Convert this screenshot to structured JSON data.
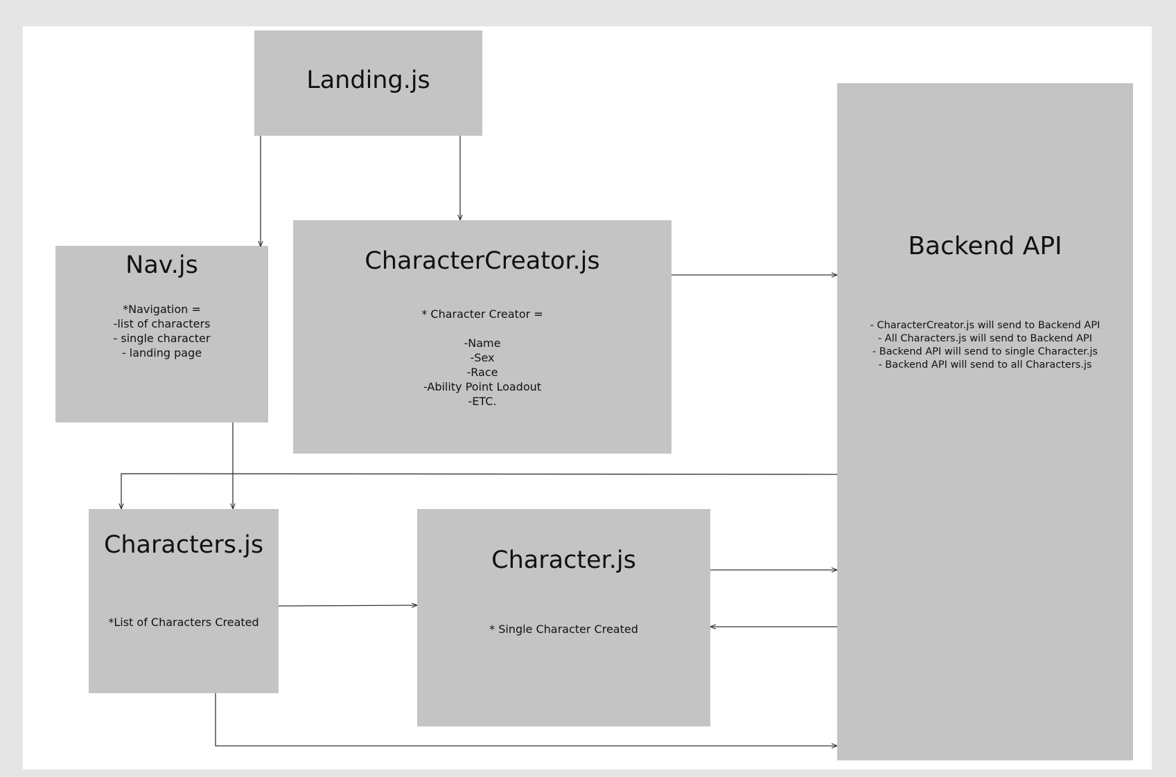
{
  "nodes": {
    "landing": {
      "title": "Landing.js",
      "body": ""
    },
    "nav": {
      "title": "Nav.js",
      "body": "*Navigation =\n-list of characters\n- single character\n- landing page"
    },
    "creator": {
      "title": "CharacterCreator.js",
      "body": "* Character Creator =\n\n-Name\n-Sex\n-Race\n-Ability Point Loadout\n-ETC."
    },
    "backend": {
      "title": "Backend API",
      "body": "- CharacterCreator.js will send to Backend API\n- All Characters.js will send to Backend API\n- Backend API will send to single Character.js\n- Backend API will send to all Characters.js"
    },
    "characters": {
      "title": "Characters.js",
      "body": "*List of Characters Created"
    },
    "character": {
      "title": "Character.js",
      "body": "* Single Character Created"
    }
  },
  "colors": {
    "page_bg": "#e5e5e5",
    "canvas_bg": "#ffffff",
    "node_fill": "#c4c4c4",
    "line": "#333333"
  }
}
